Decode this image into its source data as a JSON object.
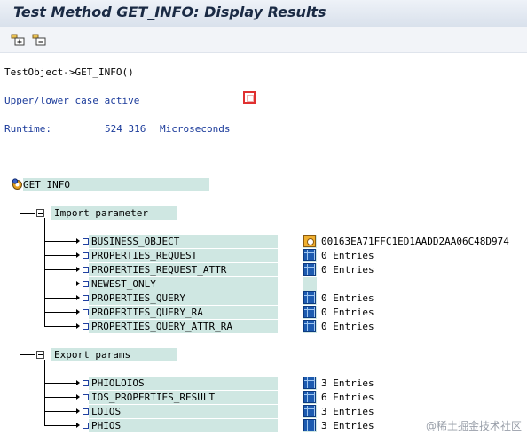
{
  "window": {
    "title": "Test Method GET_INFO: Display Results"
  },
  "toolbar": {
    "buttons": [
      {
        "name": "expand-all-icon"
      },
      {
        "name": "collapse-all-icon"
      }
    ]
  },
  "header": {
    "call": "TestObject->GET_INFO()",
    "case_label": "Upper/lower case active",
    "runtime_label": "Runtime:",
    "runtime_value": "524 316",
    "runtime_unit": "Microseconds"
  },
  "tree": {
    "root": "GET_INFO",
    "import": {
      "label": "Import parameter",
      "rows": [
        {
          "name": "BUSINESS_OBJECT",
          "icon": "object-icon",
          "value": "00163EA71FFC1ED1AADD2AA06C48D974"
        },
        {
          "name": "PROPERTIES_REQUEST",
          "icon": "table-icon",
          "value": "0 Entries"
        },
        {
          "name": "PROPERTIES_REQUEST_ATTR",
          "icon": "table-icon",
          "value": "0 Entries"
        },
        {
          "name": "NEWEST_ONLY",
          "icon": "",
          "value": ""
        },
        {
          "name": "PROPERTIES_QUERY",
          "icon": "table-icon",
          "value": "0 Entries"
        },
        {
          "name": "PROPERTIES_QUERY_RA",
          "icon": "table-icon",
          "value": "0 Entries"
        },
        {
          "name": "PROPERTIES_QUERY_ATTR_RA",
          "icon": "table-icon",
          "value": "0 Entries"
        }
      ]
    },
    "export": {
      "label": "Export params",
      "rows": [
        {
          "name": "PHIOLOIOS",
          "icon": "table-icon",
          "value": "3 Entries"
        },
        {
          "name": "IOS_PROPERTIES_RESULT",
          "icon": "table-icon",
          "value": "6 Entries"
        },
        {
          "name": "LOIOS",
          "icon": "table-icon",
          "value": "3 Entries"
        },
        {
          "name": "PHIOS",
          "icon": "table-icon",
          "value": "3 Entries"
        }
      ]
    }
  },
  "watermark": "@稀土掘金技术社区"
}
